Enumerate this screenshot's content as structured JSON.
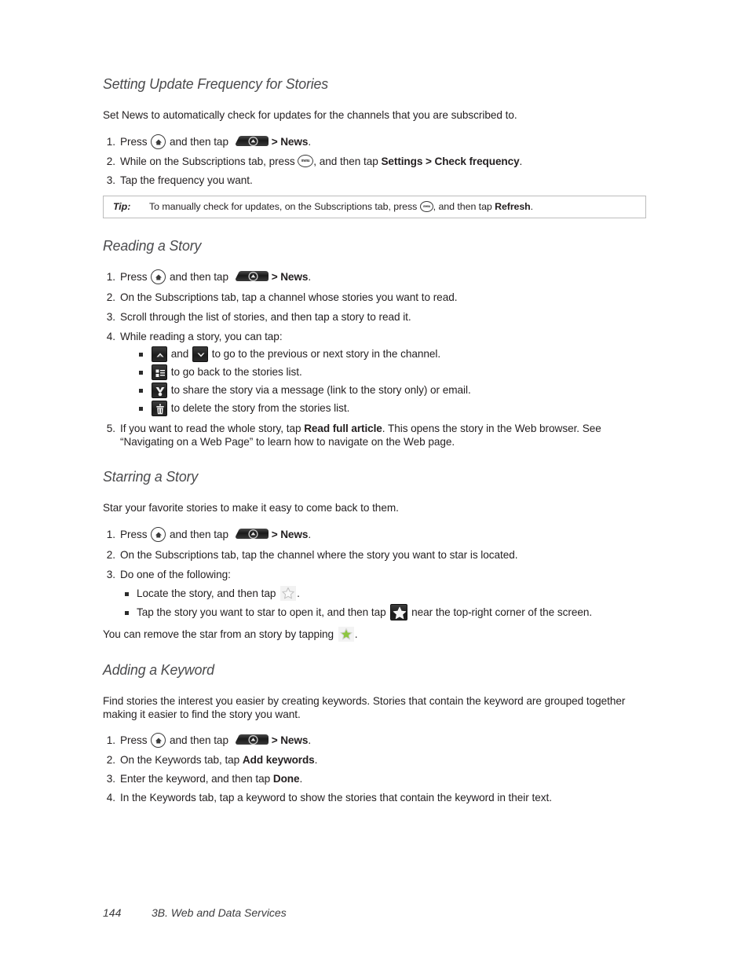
{
  "page": {
    "footer_page_number": "144",
    "footer_chapter": "3B. Web and Data Services"
  },
  "icons": {
    "home_key": "home-key-icon",
    "menu_key": "menu-key-icon",
    "menu_key_label": "menu",
    "app_launcher": "app-launcher-icon",
    "prev_story": "chevron-up-icon",
    "next_story": "chevron-down-icon",
    "stories_list": "list-view-icon",
    "share": "share-icon",
    "delete": "trash-icon",
    "star_outline": "star-outline-icon",
    "star_boxed": "star-boxed-icon",
    "star_green": "star-green-icon"
  },
  "colors": {
    "heading": "#4a4a4c",
    "body_text": "#231f20",
    "tip_border": "#bcbcbc",
    "star_green": "#8dc63f",
    "button_dark": "#1c1c1c"
  },
  "sections": [
    {
      "id": "setting-update-frequency",
      "heading": "Setting Update Frequency for Stories",
      "intro": "Set News to automatically check for updates for the channels that you are subscribed to.",
      "steps": [
        {
          "num": "1.",
          "parts": [
            {
              "t": "text",
              "v": "Press "
            },
            {
              "t": "icon",
              "v": "home_key"
            },
            {
              "t": "text",
              "v": " and then tap "
            },
            {
              "t": "icon",
              "v": "app_launcher"
            },
            {
              "t": "bold",
              "v": "> News"
            },
            {
              "t": "text",
              "v": "."
            }
          ]
        },
        {
          "num": "2.",
          "parts": [
            {
              "t": "text",
              "v": "While on the Subscriptions tab, press "
            },
            {
              "t": "icon",
              "v": "menu_key"
            },
            {
              "t": "text",
              "v": ", and then tap "
            },
            {
              "t": "bold",
              "v": "Settings > Check frequency"
            },
            {
              "t": "text",
              "v": "."
            }
          ]
        },
        {
          "num": "3.",
          "parts": [
            {
              "t": "text",
              "v": "Tap the frequency you want."
            }
          ]
        }
      ]
    },
    {
      "id": "reading-a-story",
      "heading": "Reading a Story"
    },
    {
      "id": "starring-a-story",
      "heading": "Starring a Story",
      "intro": "Star your favorite stories to make it easy to come back to them."
    },
    {
      "id": "adding-a-keyword",
      "heading": "Adding a Keyword",
      "intro": "Find stories the interest you easier by creating keywords. Stories that contain the keyword are grouped together making it easier to find the story you want."
    }
  ],
  "tip": {
    "label": "Tip:",
    "text_before_icon": "To manually check for updates, on the Subscriptions tab, press ",
    "text_after_icon": ", and then tap ",
    "bold_word": "Refresh",
    "text_end": "."
  },
  "reading_steps": {
    "s1_press": "Press ",
    "s1_and_then_tap": " and then tap ",
    "s1_news": "> News",
    "s1_period": ".",
    "s2": "On the Subscriptions tab, tap a channel whose stories you want to read.",
    "s3": "Scroll through the list of stories, and then tap a story to read it.",
    "s4": "While reading a story, you can tap:",
    "b1_and": " and ",
    "b1_tail": " to go to the previous or next story in the channel.",
    "b2": " to go back to the stories list.",
    "b3": " to share the story via a message (link to the story only) or email.",
    "b4": " to delete the story from the stories list.",
    "s5_a": "If you want to read the whole story, tap ",
    "s5_bold": "Read full article",
    "s5_b": ". This opens the story in the Web browser. See “Navigating on a Web Page” to learn how to navigate on the Web page.",
    "nums": [
      "1.",
      "2.",
      "3.",
      "4.",
      "5."
    ]
  },
  "starring_steps": {
    "s1_press": "Press ",
    "s1_and_then_tap": " and then tap ",
    "s1_news": "> News",
    "s1_period": ".",
    "s2": "On the Subscriptions tab, tap the channel where the story you want to star is located.",
    "s3": "Do one of the following:",
    "b1": "Locate the story, and then tap ",
    "b1_end": ".",
    "b2_a": "Tap the story you want to star to open it, and then tap ",
    "b2_b": " near the top-right corner of the screen.",
    "outro_a": "You can remove the star from an story by tapping ",
    "outro_b": ".",
    "nums": [
      "1.",
      "2.",
      "3."
    ]
  },
  "keyword_steps": {
    "s1_press": "Press ",
    "s1_and_then_tap": " and then tap ",
    "s1_news": "> News",
    "s1_period": ".",
    "s2_a": "On the Keywords tab, tap ",
    "s2_bold": "Add keywords",
    "s2_b": ".",
    "s3_a": "Enter the keyword, and then tap ",
    "s3_bold": "Done",
    "s3_b": ".",
    "s4": "In the Keywords tab, tap a keyword to show the stories that contain the keyword in their text.",
    "nums": [
      "1.",
      "2.",
      "3.",
      "4."
    ]
  }
}
